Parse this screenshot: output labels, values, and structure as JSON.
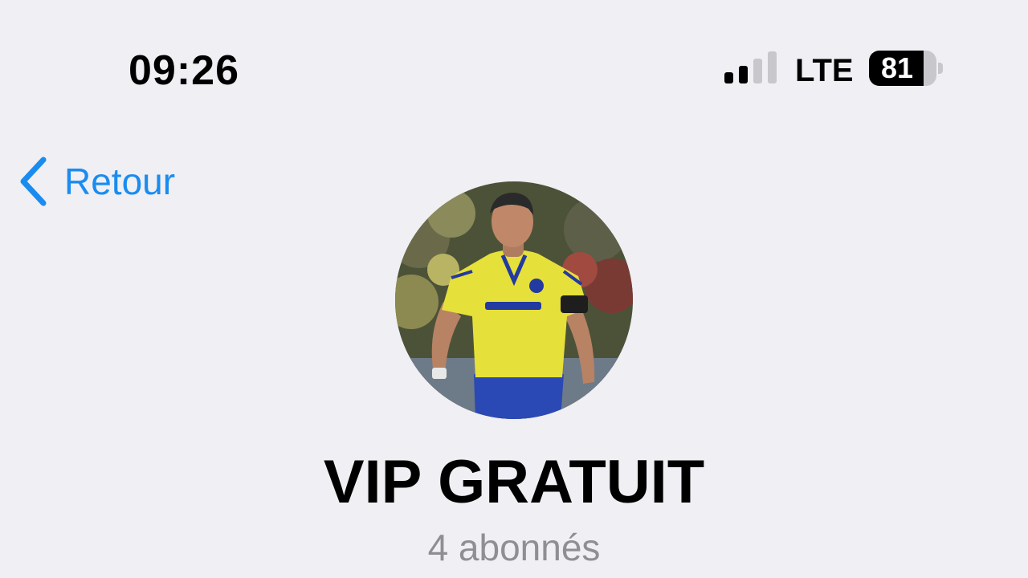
{
  "status_bar": {
    "time": "09:26",
    "network": "LTE",
    "battery_level": "81",
    "battery_fraction": 0.81,
    "signal_bars_active": 2,
    "signal_bars_total": 4,
    "icon": "cellular-signal-icon"
  },
  "nav": {
    "back_label": "Retour",
    "back_icon": "chevron-left-icon",
    "accent_color": "#1a8cf0"
  },
  "channel": {
    "avatar_icon": "channel-avatar-photo",
    "title": "VIP GRATUIT",
    "subscribers": "4 abonnés"
  },
  "colors": {
    "background": "#efeff4",
    "secondary_text": "#8e8e93"
  }
}
